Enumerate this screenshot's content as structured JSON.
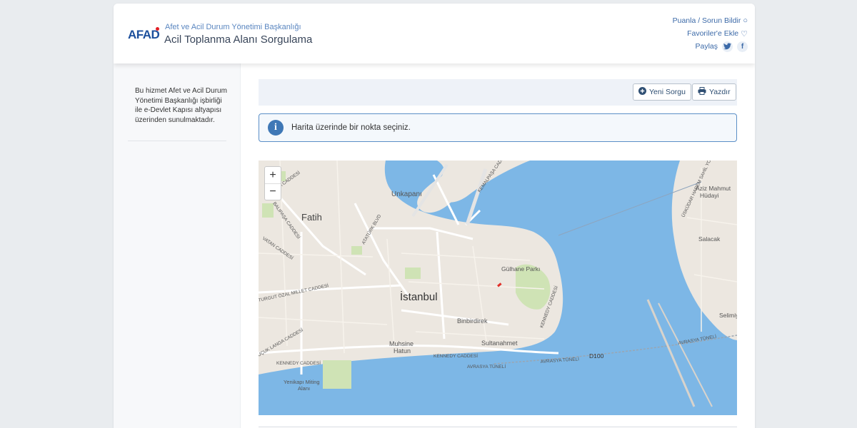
{
  "header": {
    "logo_text": "AFAD",
    "subtitle": "Afet ve Acil Durum Yönetimi Başkanlığı",
    "title": "Acil Toplanma Alanı Sorgulama",
    "links": {
      "rate_label": "Puanla / Sorun Bildir",
      "favorite_label": "Favoriler'e Ekle",
      "share_label": "Paylaş"
    }
  },
  "sidebar": {
    "note": "Bu hizmet Afet ve Acil Durum Yönetimi Başkanlığı işbirliği ile e-Devlet Kapısı altyapısı üzerinden sunulmaktadır."
  },
  "toolbar": {
    "new_query_label": "Yeni Sorgu",
    "print_label": "Yazdır"
  },
  "info": {
    "message": "Harita üzerinde bir nokta seçiniz."
  },
  "map": {
    "zoom_in": "+",
    "zoom_out": "−",
    "labels": {
      "fatih": "Fatih",
      "istanbul": "İstanbul",
      "unkapani": "Unkapanı",
      "gulhane": "Gülhane Parkı",
      "binbirdirek": "Binbirdirek",
      "sultanahmet": "Sultanahmet",
      "muhsine": "Muhsine",
      "hatun": "Hatun",
      "yenikapi1": "Yenikapı Miting",
      "yenikapi2": "Alanı",
      "aziz1": "Aziz Mahmut",
      "aziz2": "Hüdayi",
      "salacak": "Salacak",
      "selimiye": "Selimiy",
      "d100": "D100",
      "avrasya1": "AVRASYA TÜNELİ",
      "avrasya2": "AVRASYA TÜNELİ",
      "avrasya3": "AVRASYA TÜNELİ",
      "kennedy1": "KENNEDY CADDESİ",
      "kennedy2": "KENNEDY CADDESİ",
      "kennedy3": "KENNEDY CADDESİ",
      "ataturk": "ATATÜRK BLVD",
      "millet": "TURGUT ÖZAL MILLET CADDESİ",
      "vatan": "VATAN CADDESİ",
      "balipasa": "BALIPAŞA CADDESİ",
      "pasa": "PAŞA CADDESİ",
      "langa": "UÇUK LANGA CADDESİ",
      "kemalpasa": "KEMALPAŞA CADDESİ",
      "uskudar": "ÜSKÜDAR HAREM SAHİL YOLU",
      "kenedy_east": "KENNEDY CADDESİ"
    },
    "colors": {
      "water": "#7db7e6",
      "land": "#ece7e0",
      "park": "#cfe3b5",
      "marker": "#e0302a"
    }
  }
}
